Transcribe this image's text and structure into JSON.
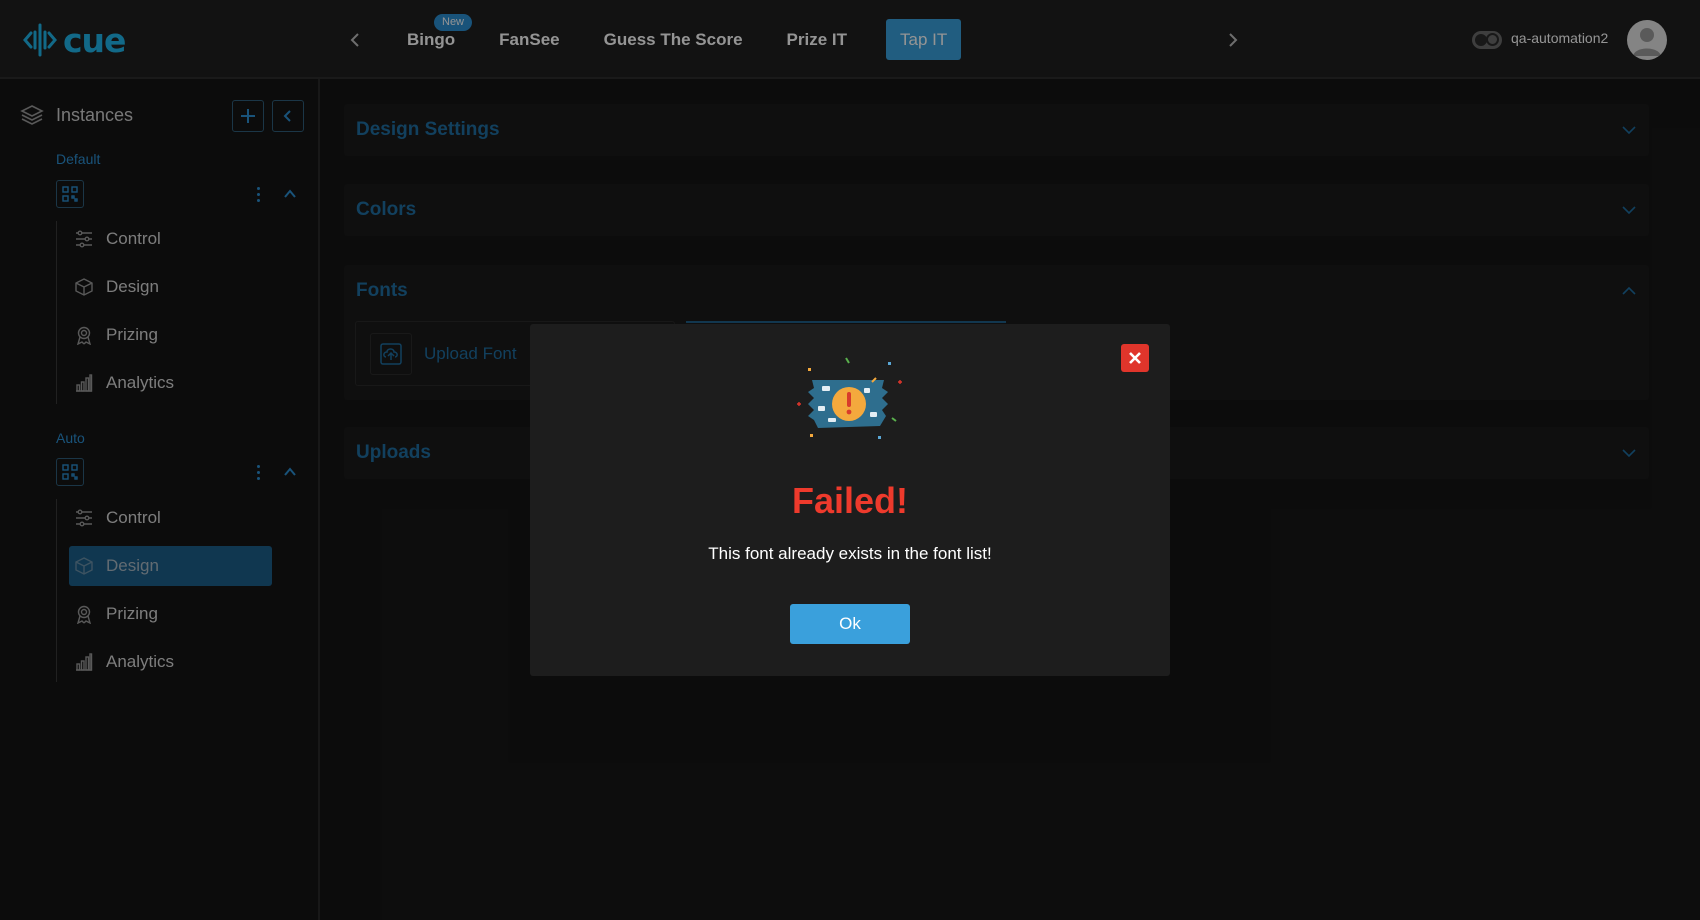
{
  "header": {
    "logo_text": "cue",
    "tabs": [
      {
        "label": "Bingo",
        "badge": "New"
      },
      {
        "label": "FanSee"
      },
      {
        "label": "Guess The Score"
      },
      {
        "label": "Prize IT"
      },
      {
        "label": "Tap IT",
        "active": true
      }
    ],
    "username": "qa-automation2"
  },
  "sidebar": {
    "title": "Instances",
    "groups": [
      {
        "label": "Default",
        "items": [
          "Control",
          "Design",
          "Prizing",
          "Analytics"
        ]
      },
      {
        "label": "Auto",
        "items": [
          "Control",
          "Design",
          "Prizing",
          "Analytics"
        ],
        "active_item": "Design"
      }
    ]
  },
  "main": {
    "sections": [
      "Design Settings",
      "Colors",
      "Fonts",
      "Uploads"
    ],
    "upload_font_label": "Upload Font"
  },
  "modal": {
    "title": "Failed!",
    "message": "This font already exists in the font list!",
    "ok_label": "Ok"
  },
  "colors": {
    "accent": "#3aa0dc",
    "error": "#ee3a2c",
    "brand": "#1fb6ea"
  }
}
